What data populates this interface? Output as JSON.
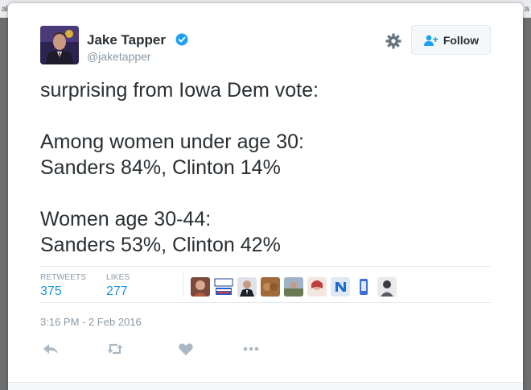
{
  "background_fragments": {
    "left": "al",
    "right": "a"
  },
  "author": {
    "name": "Jake Tapper",
    "handle": "@jaketapper",
    "verified": true
  },
  "follow_button": {
    "label": "Follow"
  },
  "tweet": {
    "text": "surprising from Iowa Dem vote:\n\nAmong women under age 30:\nSanders 84%, Clinton 14%\n\nWomen age 30-44:\nSanders 53%, Clinton 42%"
  },
  "stats": {
    "retweets_label": "RETWEETS",
    "retweets_count": "375",
    "likes_label": "LIKES",
    "likes_count": "277"
  },
  "liker_avatars": [
    "avatar-1",
    "avatar-2-vote-bernie",
    "avatar-3",
    "avatar-4",
    "avatar-5",
    "avatar-6",
    "avatar-7",
    "avatar-8-n",
    "avatar-9",
    "avatar-10"
  ],
  "timestamp": "3:16 PM - 2 Feb 2016",
  "actions": [
    "reply-icon",
    "retweet-icon",
    "like-icon",
    "more-icon"
  ],
  "colors": {
    "link_blue": "#1b95e0",
    "verified_blue": "#1da1f2",
    "muted_text": "#8899a6",
    "action_icon": "#aab8c2"
  }
}
